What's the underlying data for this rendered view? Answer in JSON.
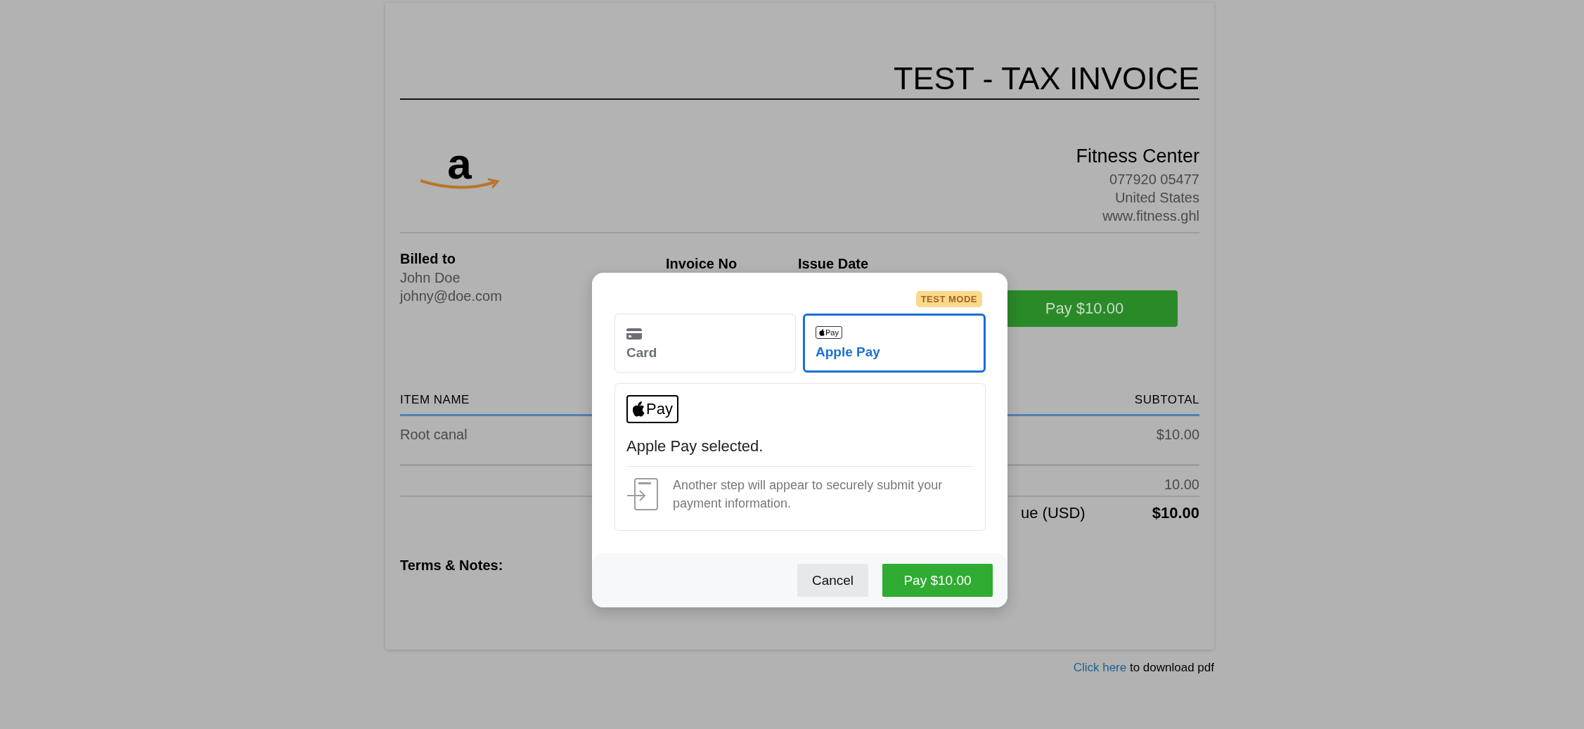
{
  "invoice": {
    "title": "TEST - TAX INVOICE",
    "logo_text": "a",
    "company": {
      "name": "Fitness Center",
      "lines": [
        "077920 05477",
        "United States",
        "www.fitness.ghl"
      ]
    },
    "billed_to": {
      "label": "Billed to",
      "lines": [
        "John Doe",
        "johny@doe.com"
      ]
    },
    "invoice_no_label": "Invoice No",
    "issue_date_label": "Issue Date",
    "pay_button": "Pay $10.00",
    "table": {
      "columns": [
        "ITEM NAME",
        "SUBTOTAL"
      ],
      "rows": [
        {
          "item": "Root canal",
          "subtotal": "$10.00"
        }
      ]
    },
    "totals": [
      {
        "value": "10.00",
        "kind": "plain"
      },
      {
        "label": "ue (USD)",
        "value": "$10.00",
        "kind": "bold"
      }
    ],
    "terms_label": "Terms & Notes:"
  },
  "download": {
    "link": "Click here",
    "text": " to download pdf"
  },
  "modal": {
    "badge": "TEST MODE",
    "tabs": [
      {
        "label": "Card",
        "kind": "card",
        "selected": false
      },
      {
        "label": "Apple Pay",
        "kind": "applepay",
        "selected": true
      }
    ],
    "tab_logo_text": "Pay",
    "logo_text": "Pay",
    "message": "Apple Pay selected.",
    "note": "Another step will appear to securely submit your payment information.",
    "buttons": [
      {
        "label": "Cancel",
        "kind": "secondary"
      },
      {
        "label": "Pay $10.00",
        "kind": "primary"
      }
    ]
  }
}
